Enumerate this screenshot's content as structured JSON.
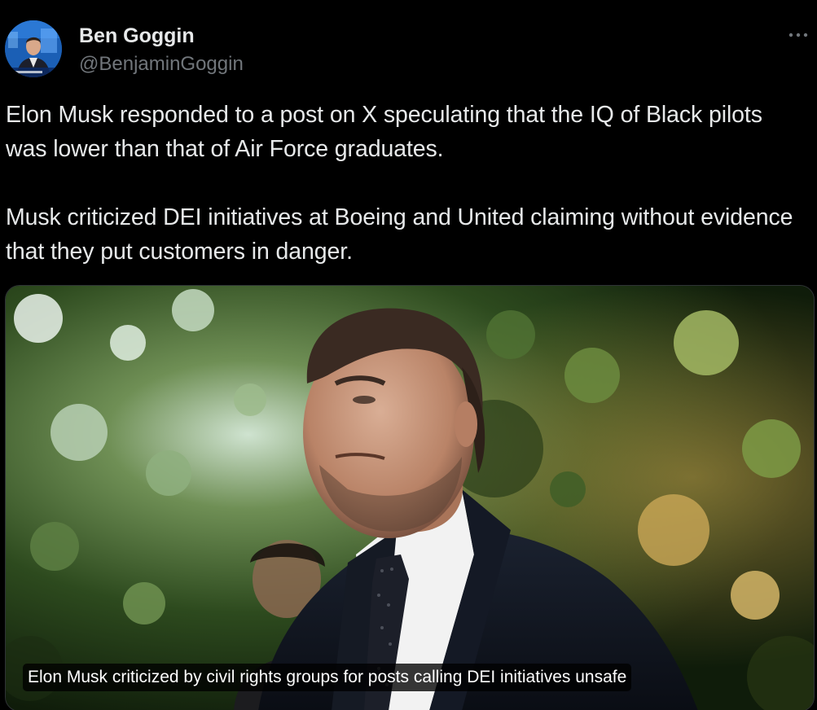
{
  "tweet": {
    "author": {
      "name": "Ben Goggin",
      "handle": "@BenjaminGoggin"
    },
    "text": {
      "paragraph_1": "Elon Musk responded to a post on X speculating that the IQ of Black pilots was lower than that of Air Force graduates.",
      "paragraph_2": "Musk criticized DEI initiatives at Boeing and United claiming without evidence that they put customers in danger."
    },
    "media": {
      "caption": "Elon Musk criticized by civil rights groups for posts calling DEI initiatives unsafe"
    }
  },
  "icons": {
    "more": "more-horizontal-icon"
  },
  "colors": {
    "background": "#000000",
    "text_primary": "#e7e9ea",
    "text_secondary": "#71767b",
    "border": "#2f3336"
  }
}
